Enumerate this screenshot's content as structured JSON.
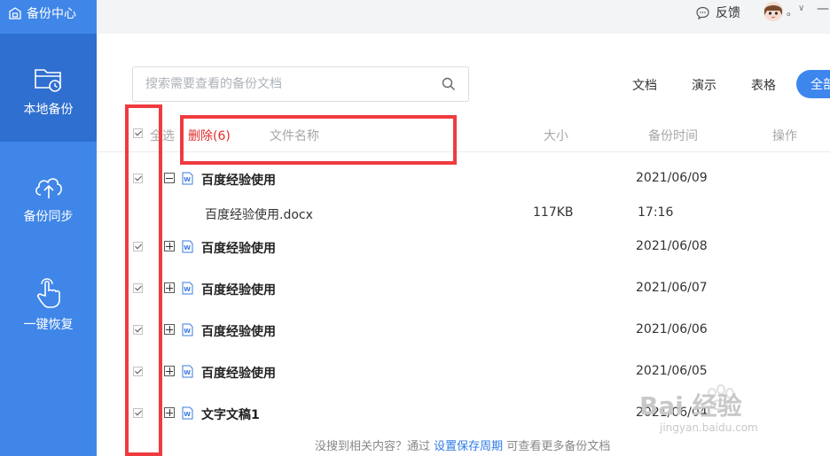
{
  "sidebar": {
    "brand": "备份中心",
    "items": [
      {
        "label": "本地备份",
        "icon": "folder-clock-icon"
      },
      {
        "label": "备份同步",
        "icon": "cloud-upload-icon"
      },
      {
        "label": "一键恢复",
        "icon": "hand-pointer-icon"
      }
    ]
  },
  "topbar": {
    "feedback": "反馈",
    "avatar_dot": "。",
    "chevron": "∨",
    "minimize": "—"
  },
  "search": {
    "placeholder": "搜索需要查看的备份文档"
  },
  "filters": {
    "doc": "文档",
    "ppt": "演示",
    "sheet": "表格",
    "all": "全部"
  },
  "table": {
    "select_all": "全选",
    "delete": "删除(6)",
    "col_name": "文件名称",
    "col_size": "大小",
    "col_time": "备份时间",
    "col_op": "操作"
  },
  "rows": [
    {
      "name": "百度经验使用",
      "date": "2021/06/09",
      "expanded": true
    },
    {
      "name": "百度经验使用",
      "date": "2021/06/08",
      "expanded": false
    },
    {
      "name": "百度经验使用",
      "date": "2021/06/07",
      "expanded": false
    },
    {
      "name": "百度经验使用",
      "date": "2021/06/06",
      "expanded": false
    },
    {
      "name": "百度经验使用",
      "date": "2021/06/05",
      "expanded": false
    },
    {
      "name": "文字文稿1",
      "date": "2021/06/04",
      "expanded": false
    }
  ],
  "child_row": {
    "name": "百度经验使用.docx",
    "size": "117KB",
    "time": "17:16"
  },
  "footer": {
    "text1": "没搜到相关内容？通过",
    "link": "设置保存周期",
    "text2": "可查看更多备份文档"
  },
  "watermark": {
    "text": "Bai  经验",
    "url": "jingyan.baidu.com"
  },
  "colors": {
    "sidebar": "#3f86e8",
    "sidebar_active": "#2f6fd0",
    "accent": "#3d86ee",
    "delete": "#e32b2b",
    "annotation": "#ef3b3f"
  }
}
